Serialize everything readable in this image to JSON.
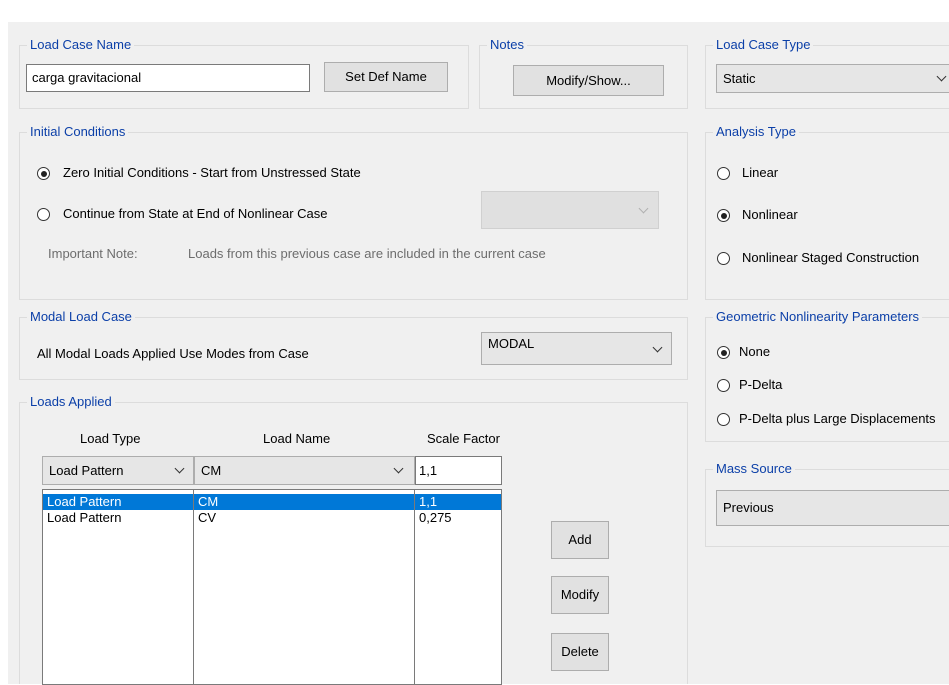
{
  "load_case_name": {
    "title": "Load Case Name",
    "value": "carga gravitacional",
    "set_def_button": "Set Def Name"
  },
  "notes": {
    "title": "Notes",
    "button": "Modify/Show..."
  },
  "load_case_type": {
    "title": "Load Case Type",
    "selected": "Static"
  },
  "initial_conditions": {
    "title": "Initial Conditions",
    "option_zero": "Zero Initial Conditions - Start from Unstressed State",
    "option_continue": "Continue from State at End of Nonlinear Case",
    "continue_case_value": "",
    "note_label": "Important Note:",
    "note_text": "Loads from this previous case are included in the current case",
    "selected": "zero"
  },
  "analysis_type": {
    "title": "Analysis Type",
    "options": [
      "Linear",
      "Nonlinear",
      "Nonlinear Staged Construction"
    ],
    "selected": "Nonlinear"
  },
  "modal_load_case": {
    "title": "Modal Load Case",
    "label": "All Modal Loads Applied Use Modes from Case",
    "selected": "MODAL"
  },
  "geometric_nonlinearity": {
    "title": "Geometric Nonlinearity Parameters",
    "options": [
      "None",
      "P-Delta",
      "P-Delta plus Large Displacements"
    ],
    "selected": "None"
  },
  "loads_applied": {
    "title": "Loads Applied",
    "headers": {
      "load_type": "Load Type",
      "load_name": "Load Name",
      "scale_factor": "Scale Factor"
    },
    "editor": {
      "load_type": "Load Pattern",
      "load_name": "CM",
      "scale_factor": "1,1"
    },
    "rows": [
      {
        "load_type": "Load Pattern",
        "load_name": "CM",
        "scale_factor": "1,1",
        "selected": true
      },
      {
        "load_type": "Load Pattern",
        "load_name": "CV",
        "scale_factor": "0,275",
        "selected": false
      }
    ],
    "buttons": {
      "add": "Add",
      "modify": "Modify",
      "delete": "Delete"
    }
  },
  "mass_source": {
    "title": "Mass Source",
    "selected": "Previous"
  }
}
